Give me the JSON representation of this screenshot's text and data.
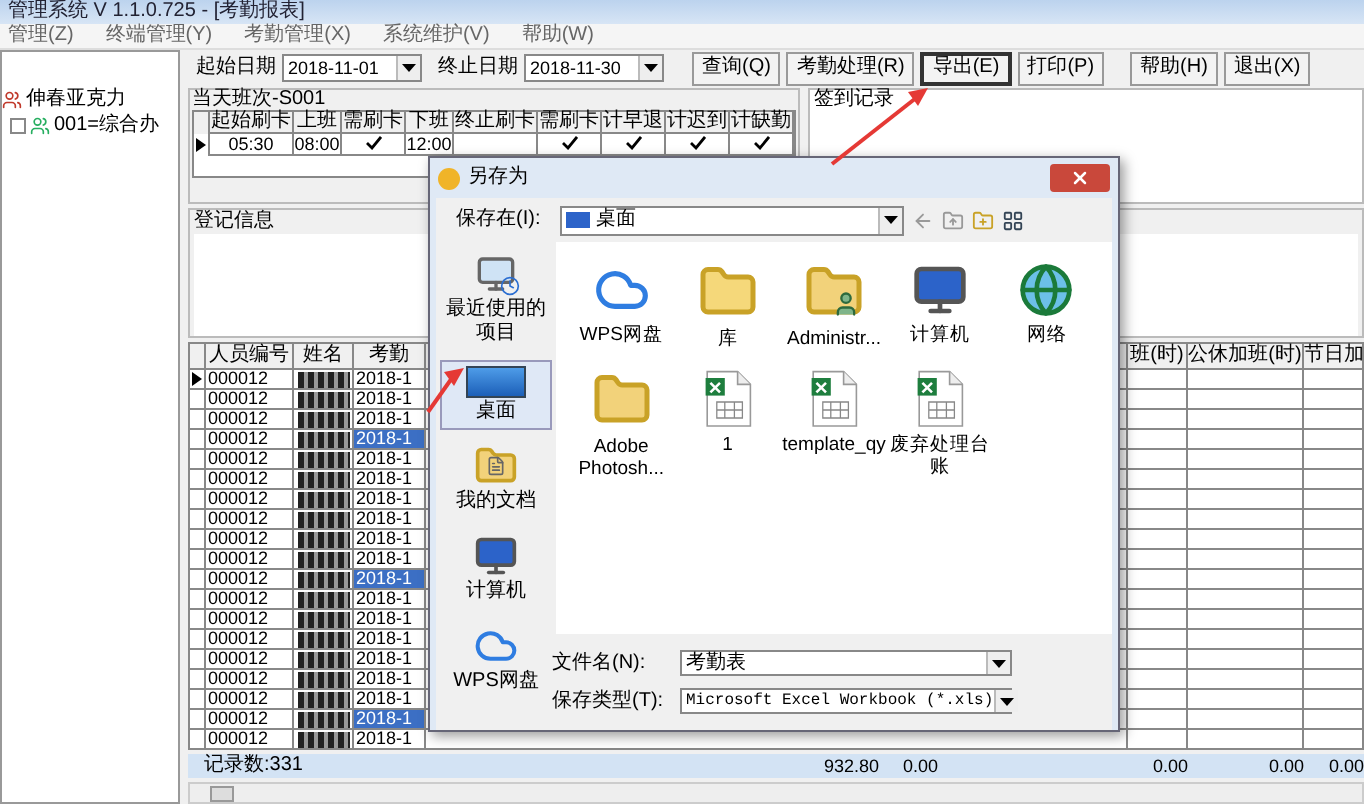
{
  "window": {
    "title": "管理系统 V 1.1.0.725 - [考勤报表]"
  },
  "menu": [
    "管理(Z)",
    "终端管理(Y)",
    "考勤管理(X)",
    "系统维护(V)",
    "帮助(W)"
  ],
  "tree": [
    {
      "label": "伸春亚克力",
      "children": [
        {
          "label": "001=综合办",
          "checked": false
        }
      ]
    }
  ],
  "filters": [
    {
      "label": "起始日期",
      "value": "2018-11-01"
    },
    {
      "label": "终止日期",
      "value": "2018-11-30"
    }
  ],
  "buttons": [
    {
      "label": "查询(Q)",
      "focused": false
    },
    {
      "label": "考勤处理(R)",
      "focused": false
    },
    {
      "label": "导出(E)",
      "focused": true
    },
    {
      "label": "打印(P)",
      "focused": false
    },
    {
      "label": "帮助(H)",
      "focused": false
    },
    {
      "label": "退出(X)",
      "focused": false
    }
  ],
  "shift": {
    "title": "当天班次-S001",
    "columns": [
      {
        "label": "起始刷卡",
        "kind": "text"
      },
      {
        "label": "上班",
        "kind": "text"
      },
      {
        "label": "需刷卡",
        "kind": "check"
      },
      {
        "label": "下班",
        "kind": "text"
      },
      {
        "label": "终止刷卡",
        "kind": "text"
      },
      {
        "label": "需刷卡",
        "kind": "check"
      },
      {
        "label": "计早退",
        "kind": "check"
      },
      {
        "label": "计迟到",
        "kind": "check"
      },
      {
        "label": "计缺勤",
        "kind": "check"
      }
    ],
    "rows": [
      {
        "current": true,
        "cells": [
          "05:30",
          "08:00",
          true,
          "12:00",
          null,
          true,
          true,
          true,
          true
        ]
      }
    ]
  },
  "checkin": {
    "title": "签到记录"
  },
  "register": {
    "title": "登记信息"
  },
  "records": {
    "columns_left": [
      "人员编号",
      "姓名",
      "考勤"
    ],
    "columns_right": [
      "班(时)",
      "公休加班(时)",
      "节日加"
    ],
    "rows": [
      {
        "id": "000012",
        "date": "2018-1",
        "current": true,
        "highlighted": false
      },
      {
        "id": "000012",
        "date": "2018-1",
        "current": false,
        "highlighted": false
      },
      {
        "id": "000012",
        "date": "2018-1",
        "current": false,
        "highlighted": false
      },
      {
        "id": "000012",
        "date": "2018-1",
        "current": false,
        "highlighted": true
      },
      {
        "id": "000012",
        "date": "2018-1",
        "current": false,
        "highlighted": false
      },
      {
        "id": "000012",
        "date": "2018-1",
        "current": false,
        "highlighted": false
      },
      {
        "id": "000012",
        "date": "2018-1",
        "current": false,
        "highlighted": false
      },
      {
        "id": "000012",
        "date": "2018-1",
        "current": false,
        "highlighted": false
      },
      {
        "id": "000012",
        "date": "2018-1",
        "current": false,
        "highlighted": false
      },
      {
        "id": "000012",
        "date": "2018-1",
        "current": false,
        "highlighted": false
      },
      {
        "id": "000012",
        "date": "2018-1",
        "current": false,
        "highlighted": true
      },
      {
        "id": "000012",
        "date": "2018-1",
        "current": false,
        "highlighted": false
      },
      {
        "id": "000012",
        "date": "2018-1",
        "current": false,
        "highlighted": false
      },
      {
        "id": "000012",
        "date": "2018-1",
        "current": false,
        "highlighted": false
      },
      {
        "id": "000012",
        "date": "2018-1",
        "current": false,
        "highlighted": false
      },
      {
        "id": "000012",
        "date": "2018-1",
        "current": false,
        "highlighted": false
      },
      {
        "id": "000012",
        "date": "2018-1",
        "current": false,
        "highlighted": false
      },
      {
        "id": "000012",
        "date": "2018-1",
        "current": false,
        "highlighted": true
      },
      {
        "id": "000012",
        "date": "2018-1",
        "current": false,
        "highlighted": false
      }
    ],
    "count": "记录数:331",
    "totals": [
      "932.80",
      "0.00",
      "0.00",
      "0.00",
      "0.00"
    ]
  },
  "dialog": {
    "title": "另存为",
    "location_label": "保存在(I):",
    "location": "桌面",
    "places": [
      {
        "label": "最近使用的项目",
        "kind": "recent",
        "selected": false
      },
      {
        "label": "桌面",
        "kind": "desktop",
        "selected": true
      },
      {
        "label": "我的文档",
        "kind": "documents",
        "selected": false
      },
      {
        "label": "计算机",
        "kind": "computer",
        "selected": false
      },
      {
        "label": "WPS网盘",
        "kind": "cloud",
        "selected": false
      }
    ],
    "items": [
      {
        "name": "WPS网盘",
        "kind": "cloud"
      },
      {
        "name": "库",
        "kind": "library"
      },
      {
        "name": "Administr...",
        "kind": "user"
      },
      {
        "name": "计算机",
        "kind": "computer"
      },
      {
        "name": "网络",
        "kind": "network"
      },
      {
        "name": "Adobe Photosh...",
        "kind": "folder"
      },
      {
        "name": "1",
        "kind": "excel"
      },
      {
        "name": "template_qy",
        "kind": "excel"
      },
      {
        "name": "废弃处理台账",
        "kind": "excel"
      }
    ],
    "filename_label": "文件名(N):",
    "filename": "考勤表",
    "type_label": "保存类型(T):",
    "type": "Microsoft Excel Workbook (*.xls)"
  }
}
